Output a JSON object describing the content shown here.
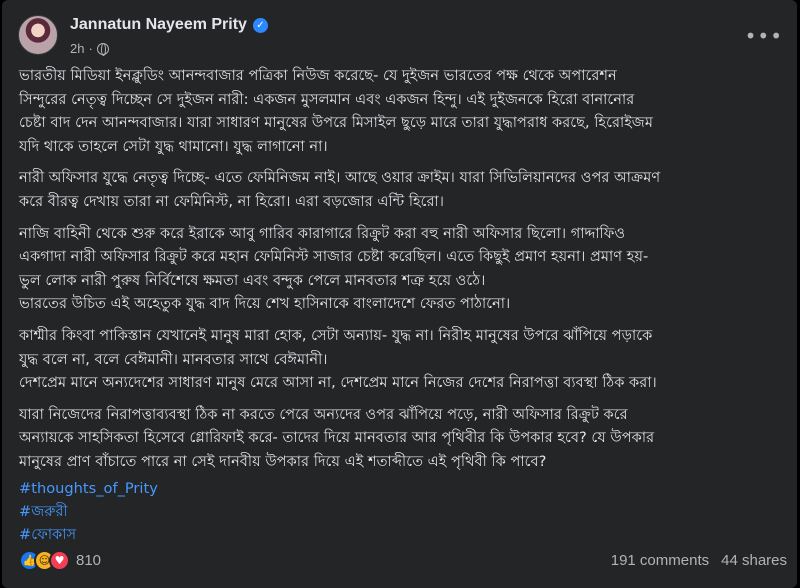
{
  "post": {
    "author": "Jannatun Nayeem Prity",
    "time": "2h",
    "separator": "·",
    "more_icon": "more-horizontal-icon",
    "paragraphs": [
      [
        "ভারতীয় মিডিয়া ইনক্লুডিং আনন্দবাজার পত্রিকা নিউজ করেছে- যে দুইজন ভারতের পক্ষ থেকে অপারেশন",
        "সিন্দুরের নেতৃত্ব দিচ্ছেন সে দুইজন নারী: একজন মুসলমান এবং একজন হিন্দু। এই দুইজনকে হিরো বানানোর",
        "চেষ্টা বাদ দেন আনন্দবাজার। যারা সাধারণ মানুষের উপরে মিসাইল ছুড়ে মারে তারা যুদ্ধাপরাধ করছে, হিরোইজম",
        "যদি থাকে তাহলে সেটা যুদ্ধ থামানো। যুদ্ধ লাগানো না।"
      ],
      [
        "নারী অফিসার যুদ্ধে নেতৃত্ব দিচ্ছে- এতে ফেমিনিজম নাই। আছে ওয়ার ক্রাইম। যারা সিভিলিয়ানদের ওপর আক্রমণ",
        "করে বীরত্ব দেখায় তারা না ফেমিনিস্ট, না হিরো। এরা বড়জোর এন্টি হিরো।"
      ],
      [
        "নাজি বাহিনী থেকে শুরু করে ইরাকে আবু গারিব কারাগারে রিক্রুট করা বহু নারী অফিসার ছিলো। গাদ্দাফিও",
        "একগাদা নারী অফিসার রিক্রুট করে মহান ফেমিনিস্ট সাজার চেষ্টা করেছিল। এতে কিছুই প্রমাণ হয়না। প্রমাণ হয়-",
        "ভুল লোক নারী পুরুষ নির্বিশেষে ক্ষমতা এবং বন্দুক পেলে মানবতার শত্রু হয়ে ওঠে।",
        "ভারতের উচিত এই অহেতুক যুদ্ধ বাদ দিয়ে শেখ হাসিনাকে বাংলাদেশে ফেরত পাঠানো।"
      ],
      [
        "কাশ্মীর কিংবা পাকিস্তান যেখানেই মানুষ মারা হোক, সেটা অন্যায়- যুদ্ধ না। নিরীহ মানুষের উপরে ঝাঁপিয়ে পড়াকে",
        "যুদ্ধ বলে না, বলে বেঈমানী। মানবতার সাথে বেঈমানী।",
        "দেশপ্রেম মানে অন্যদেশের সাধারণ মানুষ মেরে আসা না, দেশপ্রেম মানে নিজের দেশের নিরাপত্তা ব্যবস্থা ঠিক করা।"
      ],
      [
        "যারা নিজেদের নিরাপত্তাব্যবস্থা ঠিক না করতে পেরে অন্যদের ওপর ঝাঁপিয়ে পড়ে, নারী অফিসার রিক্রুট করে",
        "অন্যায়কে সাহসিকতা হিসেবে গ্লোরিফাই করে- তাদের দিয়ে মানবতার আর পৃথিবীর কি উপকার হবে? যে উপকার",
        "মানুষের প্রাণ বাঁচাতে পারে না সেই দানবীয় উপকার দিয়ে এই শতাব্দীতে এই পৃথিবী কি পাবে?"
      ]
    ],
    "hashtags": [
      "#thoughts_of_Prity",
      "#জরুরী",
      "#ফোকাস"
    ],
    "reaction_count": "810",
    "reactions": [
      "like",
      "haha",
      "love"
    ],
    "comments": "191 comments",
    "shares": "44 shares",
    "colors": {
      "background": "#242526",
      "text": "#e4e6eb",
      "muted": "#b0b3b8",
      "link": "#4599ff",
      "verified": "#2d88ff"
    }
  }
}
